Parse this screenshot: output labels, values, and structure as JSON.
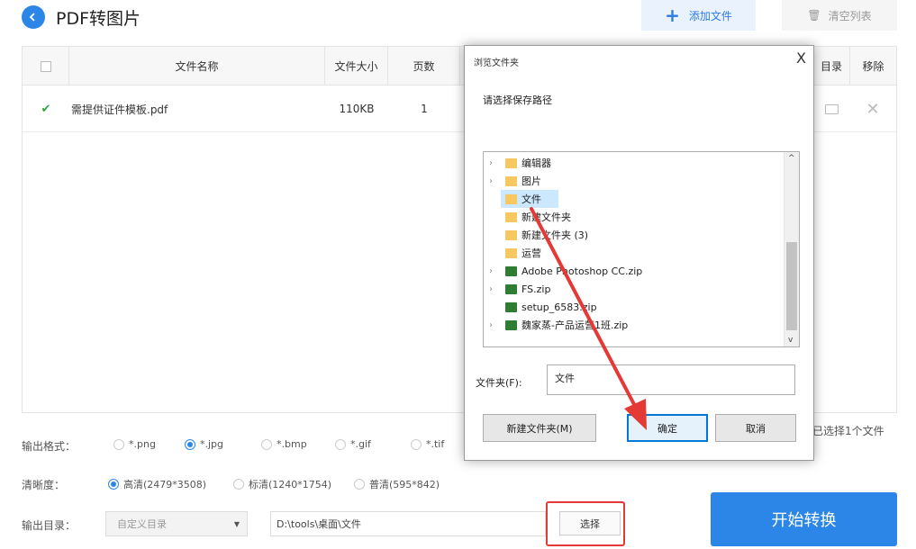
{
  "header": {
    "title": "PDF转图片",
    "add_file": "添加文件",
    "clear_list": "清空列表"
  },
  "table": {
    "columns": {
      "name": "文件名称",
      "size": "文件大小",
      "pages": "页数",
      "dir": "目录",
      "remove": "移除"
    },
    "rows": [
      {
        "checked": true,
        "name": "需提供证件模板.pdf",
        "size": "110KB",
        "pages": "1"
      }
    ],
    "selected_count": "已选择1个文件"
  },
  "options": {
    "format_label": "输出格式：",
    "formats": [
      "*.png",
      "*.jpg",
      "*.bmp",
      "*.gif",
      "*.tif"
    ],
    "format_selected": "*.jpg",
    "clarity_label": "清晰度：",
    "clarities": [
      "高清(2479*3508)",
      "标清(1240*1754)",
      "普清(595*842)"
    ],
    "clarity_selected": "高清(2479*3508)",
    "output_label": "输出目录：",
    "output_mode": "自定义目录",
    "output_path": "D:\\tools\\桌面\\文件",
    "choose": "选择",
    "start": "开始转换"
  },
  "dialog": {
    "title": "浏览文件夹",
    "close": "X",
    "prompt": "请选择保存路径",
    "tree": [
      {
        "label": "编辑器",
        "icon": "folder-icon",
        "expandable": true
      },
      {
        "label": "图片",
        "icon": "folder-icon",
        "expandable": true
      },
      {
        "label": "文件",
        "icon": "folder-icon",
        "expandable": false,
        "selected": true
      },
      {
        "label": "新建文件夹",
        "icon": "folder-icon",
        "expandable": false
      },
      {
        "label": "新建文件夹 (3)",
        "icon": "folder-icon",
        "expandable": false
      },
      {
        "label": "运营",
        "icon": "folder-icon",
        "expandable": false
      },
      {
        "label": "Adobe Photoshop CC.zip",
        "icon": "zip-icon",
        "expandable": true
      },
      {
        "label": "FS.zip",
        "icon": "zip-icon",
        "expandable": true
      },
      {
        "label": "setup_6583.zip",
        "icon": "zip-icon",
        "expandable": false
      },
      {
        "label": "魏家蒸-产品运营1班.zip",
        "icon": "zip-icon",
        "expandable": true
      }
    ],
    "folder_label": "文件夹(F):",
    "folder_value": "文件",
    "new_folder": "新建文件夹(M)",
    "ok": "确定",
    "cancel": "取消"
  },
  "colors": {
    "accent": "#2c86e8",
    "highlight_box": "#e53935",
    "arrow": "#e53935"
  }
}
